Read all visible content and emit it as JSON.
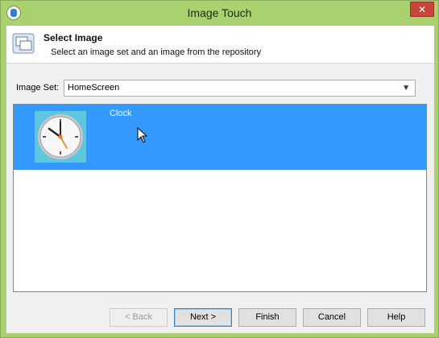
{
  "window": {
    "title": "Image Touch",
    "close_label": "✕"
  },
  "header": {
    "title": "Select Image",
    "subtitle": "Select an image set and an image from the repository"
  },
  "image_set": {
    "label": "Image Set:",
    "value": "HomeScreen"
  },
  "list": {
    "items": [
      {
        "label": "Clock"
      }
    ]
  },
  "buttons": {
    "back": "< Back",
    "next": "Next >",
    "finish": "Finish",
    "cancel": "Cancel",
    "help": "Help"
  }
}
